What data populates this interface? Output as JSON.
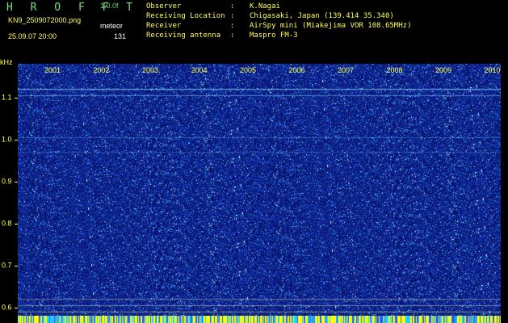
{
  "header": {
    "app_title": "H R O F F T",
    "speed": "1.0.0f",
    "filename": "KN9_2509072000.png",
    "mode": "meteor",
    "datetime": "25.09.07 20:00",
    "count": "131",
    "info": [
      {
        "label": "Observer",
        "value": "K.Nagai"
      },
      {
        "label": "Receiving Location",
        "value": "Chigasaki, Japan (139.414 35.340)"
      },
      {
        "label": "Receiver",
        "value": "AirSpy mini (Miakejima VOR 108.65MHz)"
      },
      {
        "label": "Receiving antenna",
        "value": "Maspro FM-3"
      }
    ]
  },
  "spectrogram": {
    "y_unit": "kHz",
    "y_ticks": [
      "1.1",
      "1.0",
      "0.9",
      "0.8",
      "0.7",
      "0.6"
    ],
    "y_range": [
      0.58,
      1.18
    ],
    "x_ticks": [
      "2001",
      "2002",
      "2003",
      "2004",
      "2005",
      "2006",
      "2007",
      "2008",
      "2009",
      "2010"
    ],
    "colors": {
      "background": "#0a1a78",
      "noise_low": "#2040c0",
      "noise_mid": "#20a0ff",
      "noise_high": "#ffffff",
      "label": "#ffff55"
    }
  }
}
